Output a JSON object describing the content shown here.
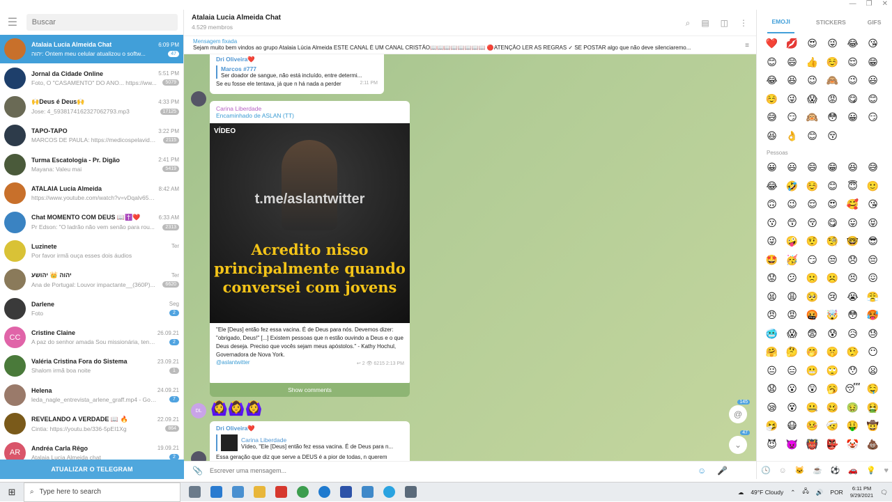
{
  "sidebar": {
    "search_placeholder": "Buscar",
    "chats": [
      {
        "name": "Atalaia Lucia Almeida Chat",
        "time": "6:09 PM",
        "preview": "יהוה: Ontem meu celular atualizou o softw...",
        "badge": "47",
        "active": true,
        "color": "#c8702b"
      },
      {
        "name": "Jornal da Cidade Online",
        "time": "5:51 PM",
        "preview": "Foto, O \"CASAMENTO\" DO ANO... https://ww...",
        "badge": "5079",
        "color": "#1e3f6b"
      },
      {
        "name": "🙌Deus é Deus🙌",
        "time": "4:33 PM",
        "preview": "Jose: 4_5938174162327062793.mp3",
        "badge": "17125",
        "color": "#6a6a55"
      },
      {
        "name": "TAPO-TAPO",
        "time": "3:22 PM",
        "preview": "MARCOS DE PAULA: https://medicospelavida...",
        "badge": "2115",
        "color": "#2d3b4a"
      },
      {
        "name": "Turma Escatologia - Pr. Digão",
        "time": "2:41 PM",
        "preview": "Mayana: Valeu mai",
        "badge": "5419",
        "color": "#4a5a3a"
      },
      {
        "name": "ATALAIA Lucia Almeida",
        "time": "8:42 AM",
        "preview": "https://www.youtube.com/watch?v=vDqalv6525s",
        "badge": "",
        "color": "#c8702b"
      },
      {
        "name": "Chat MOMENTO COM DEUS 📖✝️❤️",
        "time": "6:33 AM",
        "preview": "Pr Edson: \"O ladrão não vem senão para rou...",
        "badge": "2313",
        "color": "#3a83c2"
      },
      {
        "name": "Luzinete",
        "time": "Ter",
        "preview": "Por favor irmã ouça esses dois áudios",
        "badge": "",
        "color": "#d9c236"
      },
      {
        "name": "יהוה 👑 יהושע",
        "time": "Ter",
        "preview": "Ana de Portugal: Louvor impactante__(360P)...",
        "badge": "6620",
        "color": "#8a7a5a"
      },
      {
        "name": "Darlene",
        "time": "Seg",
        "preview": "Foto",
        "badge": "2",
        "color": "#3a3a3a"
      },
      {
        "name": "Cristine Claine",
        "time": "26.09.21",
        "preview": "A paz do senhor amada Sou missionária, tenho...",
        "badge": "2",
        "color": "#e064a8",
        "initials": "CC"
      },
      {
        "name": "Valéria Cristina Fora do Sistema",
        "time": "23.09.21",
        "preview": "Shalom irmã boa noite",
        "badge": "1",
        "color": "#4a7a3a"
      },
      {
        "name": "Helena",
        "time": "24.09.21",
        "preview": "leda_nagle_entrevista_arlene_graff.mp4 - Googl...",
        "badge": "7",
        "color": "#9a7a6a"
      },
      {
        "name": "REVELANDO A VERDADE 📖 🔥",
        "time": "22.09.21",
        "preview": "Cintia: https://youtu.be/336-5pEI1Xg",
        "badge": "864",
        "color": "#7a5a1a"
      },
      {
        "name": "Andréa Carla Rêgo",
        "time": "19.09.21",
        "preview": "Atalaia Lucia Almeida chat",
        "badge": "2",
        "color": "#d9556a",
        "initials": "AR"
      }
    ],
    "update_label": "ATUALIZAR O TELEGRAM"
  },
  "header": {
    "title": "Atalaia Lucia Almeida Chat",
    "subtitle": "4.529 membros"
  },
  "pinned": {
    "title": "Mensagem fixada",
    "text": "Sejam muito bem vindos ao grupo Atalaia Lúcia Almeida  ESTE CANAL É UM CANAL CRISTÃO📖📖📖📖📖📖📖📖  🔴ATENÇÃO LER AS REGRAS  ✓ SE POSTAR  algo  que não deve silenciaremo..."
  },
  "msg1": {
    "sender": "Dri Oliveira❤️",
    "reply_name": "Marcos #777",
    "reply_text": "Ser doador de sangue, não está incluído, entre determi...",
    "text": "Se eu fosse ele tentava, já que n há nada a perder",
    "time": "2:11 PM"
  },
  "msg2": {
    "sender": "Carina Liberdade",
    "forwarded": "Encaminhado de ASLAN (TT)",
    "video_label": "VÍDEO",
    "watermark": "t.me/aslantwitter",
    "caption": "Acredito nisso principalmente quando conversei com jovens",
    "text": "\"Ele [Deus] então fez essa vacina. É de Deus para nós. Devemos dizer: \"obrigado, Deus!\" [...] Existem pessoas que n estão ouvindo a Deus e o que Deus deseja. Preciso que vocês sejam meus apóstolos.\" - Kathy Hochul, Governadora de Nova York.",
    "link": "@aslantwitter",
    "meta": "↩ 2  👁 6215  2:13 PM",
    "show_comments": "Show comments"
  },
  "msg3": {
    "initials": "DL",
    "emojis": "🙆‍♀️🙆‍♀️🙆‍♀️"
  },
  "msg4": {
    "sender": "Dri Oliveira❤️",
    "reply_name": "Carina Liberdade",
    "reply_text": "Vídeo, \"Ele [Deus] então fez essa vacina. É de Deus para n...",
    "text": "Essa geração que diz que serve a DEUS é a pior de todas, n querem renunciar os prazeres do mundo, n querem sofrer."
  },
  "fab": {
    "mention_badge": "145",
    "down_badge": "47"
  },
  "composer": {
    "placeholder": "Escrever uma mensagem..."
  },
  "emoji_panel": {
    "tabs": [
      "EMOJI",
      "STICKERS",
      "GIFS"
    ],
    "recent": [
      "❤️",
      "💋",
      "😍",
      "😜",
      "😂",
      "😘",
      "😊",
      "😄",
      "👍",
      "☺️",
      "😌",
      "😁",
      "😂",
      "😆",
      "😉",
      "🙈",
      "😉",
      "😃",
      "☺️",
      "😜",
      "😱",
      "😡",
      "😋",
      "😊",
      "😅",
      "😏",
      "🙉",
      "😳",
      "😀",
      "😏",
      "😆",
      "👌",
      "😊",
      "😚"
    ],
    "section_people": "Pessoas",
    "people": [
      "😀",
      "😃",
      "😄",
      "😁",
      "😆",
      "😅",
      "😂",
      "🤣",
      "☺️",
      "😊",
      "😇",
      "🙂",
      "🙃",
      "😉",
      "😌",
      "😍",
      "🥰",
      "😘",
      "😗",
      "😙",
      "😚",
      "😋",
      "😛",
      "😝",
      "😜",
      "🤪",
      "🤨",
      "🧐",
      "🤓",
      "😎",
      "🤩",
      "🥳",
      "😏",
      "😒",
      "😞",
      "😔",
      "😟",
      "😕",
      "🙁",
      "☹️",
      "😣",
      "😖",
      "😫",
      "😩",
      "🥺",
      "😢",
      "😭",
      "😤",
      "😠",
      "😡",
      "🤬",
      "🤯",
      "😳",
      "🥵",
      "🥶",
      "😱",
      "😨",
      "😰",
      "😥",
      "😓",
      "🤗",
      "🤔",
      "🤭",
      "🤫",
      "🤥",
      "😶",
      "😐",
      "😑",
      "😬",
      "🙄",
      "😯",
      "😦",
      "😧",
      "😮",
      "😲",
      "🥱",
      "😴",
      "🤤",
      "😪",
      "😵",
      "🤐",
      "🥴",
      "🤢",
      "🤮",
      "🤧",
      "😷",
      "🤒",
      "🤕",
      "🤑",
      "🤠",
      "😈",
      "👿",
      "👹",
      "👺",
      "🤡",
      "💩"
    ]
  },
  "taskbar": {
    "search": "Type here to search",
    "weather": "49°F  Cloudy",
    "lang": "POR",
    "time": "6:11 PM",
    "date": "9/29/2021"
  }
}
